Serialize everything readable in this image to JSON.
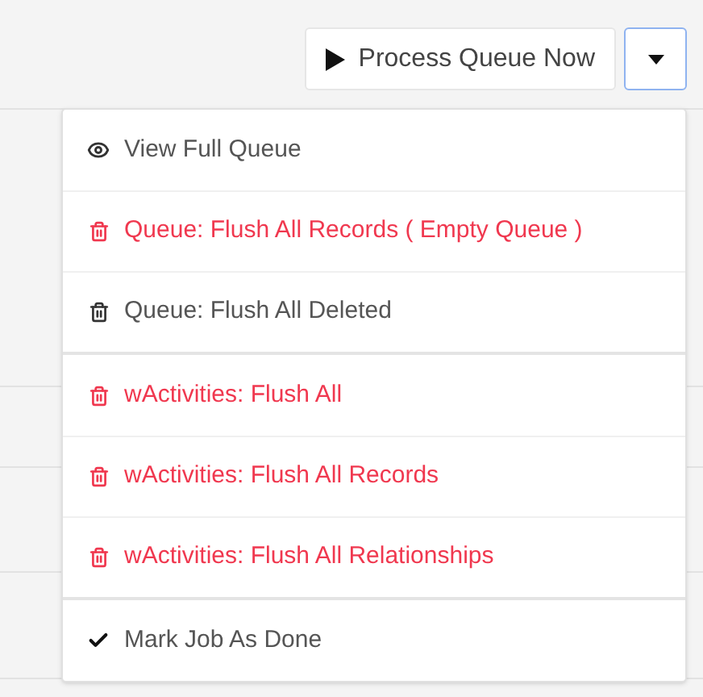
{
  "toolbar": {
    "process_button": "Process Queue Now",
    "dropdown_open": true
  },
  "menu": {
    "groups": [
      {
        "items": [
          {
            "label": "View Full Queue",
            "kind": "view"
          },
          {
            "label": "Queue: Flush All Records ( Empty Queue )",
            "kind": "danger"
          },
          {
            "label": "Queue: Flush All Deleted",
            "kind": "delete"
          }
        ]
      },
      {
        "items": [
          {
            "label": "wActivities: Flush All",
            "kind": "danger"
          },
          {
            "label": "wActivities: Flush All Records",
            "kind": "danger"
          },
          {
            "label": "wActivities: Flush All Relationships",
            "kind": "danger"
          }
        ]
      },
      {
        "items": [
          {
            "label": "Mark Job As Done",
            "kind": "done"
          }
        ]
      }
    ]
  }
}
